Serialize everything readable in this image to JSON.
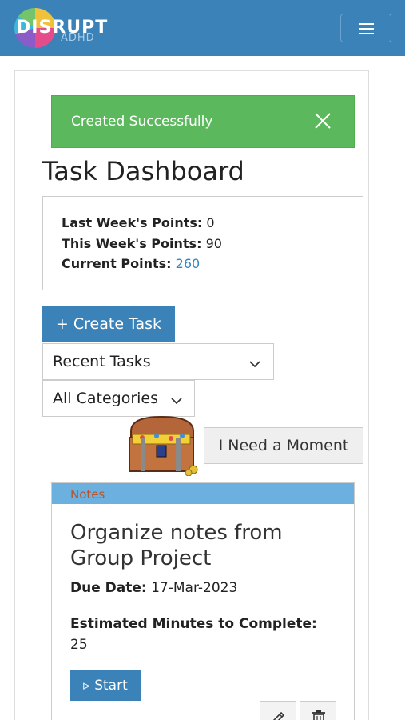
{
  "navbar": {
    "logo_text": "DISRUPT",
    "logo_sub": "ADHD",
    "menu_icon": "hamburger-menu-icon"
  },
  "alert": {
    "message": "Created Successfully",
    "close_icon": "close-icon",
    "color": "#5cb85c"
  },
  "page": {
    "title": "Task Dashboard"
  },
  "points": {
    "last_week_label": "Last Week's Points:",
    "last_week_value": "0",
    "this_week_label": "This Week's Points:",
    "this_week_value": "90",
    "current_label": "Current Points:",
    "current_value": "260"
  },
  "controls": {
    "create_label": "+ Create Task",
    "sort_selected": "Recent Tasks",
    "category_selected": "All Categories",
    "moment_label": "I Need a Moment",
    "chest_icon": "treasure-chest-icon"
  },
  "task": {
    "category": "Notes",
    "title": "Organize notes from Group Project",
    "due_label": "Due Date:",
    "due_value": "17-Mar-2023",
    "minutes_label": "Estimated Minutes to Complete:",
    "minutes_value": "25",
    "start_label": "▹ Start",
    "edit_icon": "pencil-icon",
    "delete_icon": "trash-icon"
  },
  "colors": {
    "primary": "#3b82b8",
    "accent_link": "#2f86c3",
    "task_header": "#6cb0e0",
    "category_text": "#b5552f"
  }
}
